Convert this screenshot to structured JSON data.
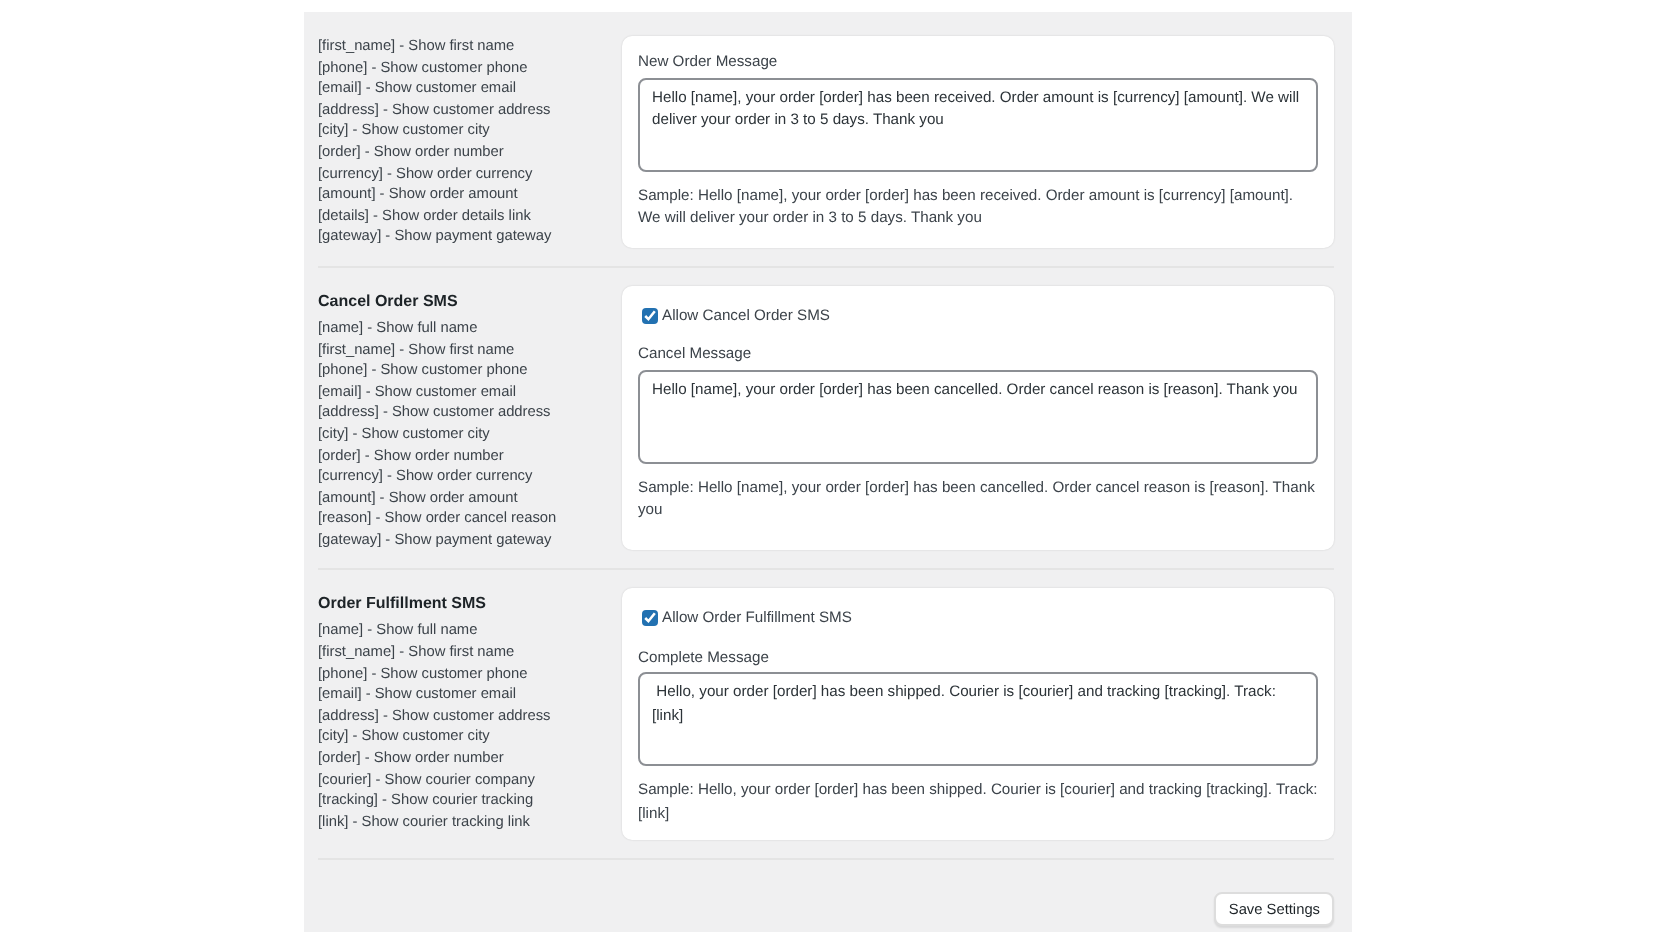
{
  "sections": [
    {
      "placeholders": [
        "[first_name] - Show first name",
        "[phone] - Show customer phone",
        "[email] - Show customer email",
        "[address] - Show customer address",
        "[city] - Show customer city",
        "[order] - Show order number",
        "[currency] - Show order currency",
        "[amount] - Show order amount",
        "[details] - Show order details link",
        "[gateway] - Show payment gateway"
      ],
      "message_label": "New Order Message",
      "message": "Hello [name], your order [order] has been received. Order amount is [currency] [amount]. We will deliver your order in 3 to 5 days. Thank you",
      "sample": "Sample: Hello [name], your order [order] has been received. Order amount is [currency] [amount]. We will deliver your order in 3 to 5 days. Thank you"
    },
    {
      "title": "Cancel Order SMS",
      "placeholders": [
        "[name] - Show full name",
        "[first_name] - Show first name",
        "[phone] - Show customer phone",
        "[email] - Show customer email",
        "[address] - Show customer address",
        "[city] - Show customer city",
        "[order] - Show order number",
        "[currency] - Show order currency",
        "[amount] - Show order amount",
        "[reason] - Show order cancel reason",
        "[gateway] - Show payment gateway"
      ],
      "toggle": {
        "label": "Allow Cancel Order SMS",
        "checked": true
      },
      "message_label": "Cancel Message",
      "message": "Hello [name], your order [order] has been cancelled. Order cancel reason is [reason]. Thank you",
      "sample": "Sample: Hello [name], your order [order] has been cancelled. Order cancel reason is [reason]. Thank you"
    },
    {
      "title": "Order Fulfillment SMS",
      "placeholders": [
        "[name] - Show full name",
        "[first_name] - Show first name",
        "[phone] - Show customer phone",
        "[email] - Show customer email",
        "[address] - Show customer address",
        "[city] - Show customer city",
        "[order] - Show order number",
        "[courier] - Show courier company",
        "[tracking] - Show courier tracking",
        "[link] - Show courier tracking link"
      ],
      "toggle": {
        "label": "Allow Order Fulfillment SMS",
        "checked": true
      },
      "message_label": "Complete Message",
      "message": " Hello, your order [order] has been shipped. Courier is [courier] and tracking [tracking]. Track: [link]",
      "sample": "Sample: Hello, your order [order] has been shipped. Courier is [courier] and tracking [tracking]. Track: [link]"
    }
  ],
  "save_button": "Save Settings"
}
